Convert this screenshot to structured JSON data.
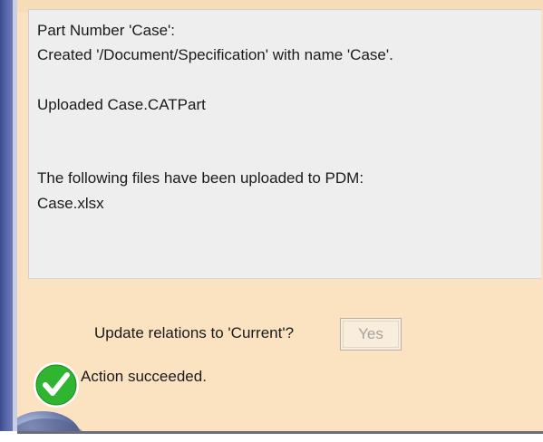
{
  "log": {
    "lines": [
      "Part Number 'Case':",
      "Created '/Document/Specification' with name 'Case'.",
      "Uploaded Case.CATPart",
      "The following files have been uploaded to PDM:",
      "Case.xlsx"
    ]
  },
  "prompt": {
    "question": "Update relations to 'Current'?",
    "yes_label": "Yes"
  },
  "status": {
    "message": "Action succeeded.",
    "icon": "check-circle-icon",
    "icon_color": "#2fb52f"
  },
  "colors": {
    "dialog_bg": "#fbe3c2",
    "panel_bg": "#eeeeee",
    "window_border": "#4b5a9c"
  }
}
